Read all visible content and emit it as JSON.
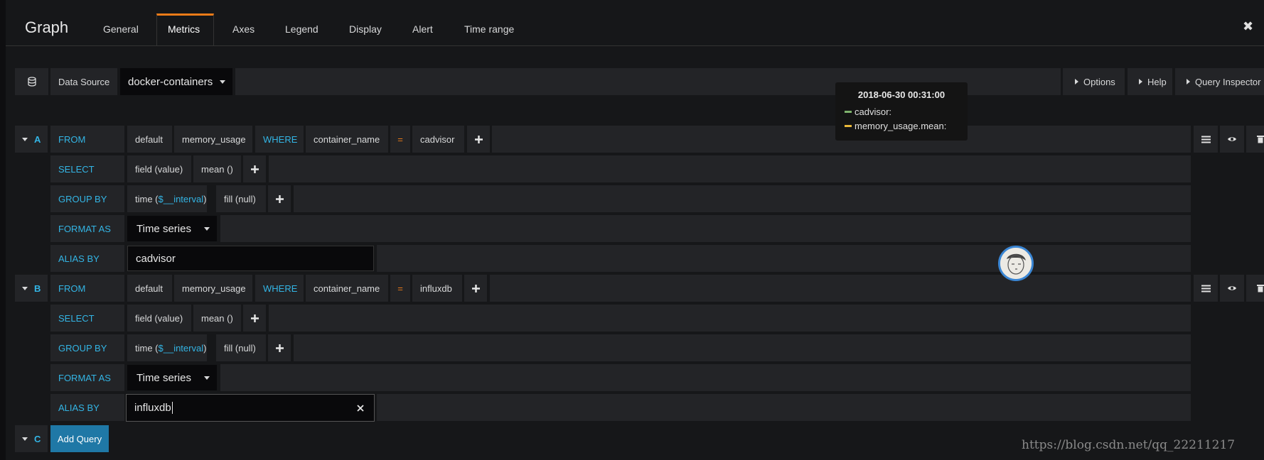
{
  "header": {
    "title": "Graph",
    "tabs": [
      "General",
      "Metrics",
      "Axes",
      "Legend",
      "Display",
      "Alert",
      "Time range"
    ],
    "active_tab": "Metrics",
    "close_glyph": "✖"
  },
  "datasource": {
    "label": "Data Source",
    "value": "docker-containers",
    "options": "Options",
    "help": "Help",
    "query_inspector": "Query Inspector"
  },
  "tooltip": {
    "time": "2018-06-30 00:31:00",
    "series": [
      {
        "name": "cadvisor:",
        "color": "#7eb26d"
      },
      {
        "name": "memory_usage.mean:",
        "color": "#eab839"
      }
    ]
  },
  "queries": [
    {
      "letter": "A",
      "from_label": "FROM",
      "policy": "default",
      "measurement": "memory_usage",
      "where_label": "WHERE",
      "tag_key": "container_name",
      "operator": "=",
      "tag_value": "cadvisor",
      "select_label": "SELECT",
      "field": "field (value)",
      "func": "mean ()",
      "group_label": "GROUP BY",
      "time_prefix": "time (",
      "interval": "$__interval",
      "time_suffix": ")",
      "fill": "fill (null)",
      "format_label": "FORMAT AS",
      "format": "Time series",
      "alias_label": "ALIAS BY",
      "alias": "cadvisor"
    },
    {
      "letter": "B",
      "from_label": "FROM",
      "policy": "default",
      "measurement": "memory_usage",
      "where_label": "WHERE",
      "tag_key": "container_name",
      "operator": "=",
      "tag_value": "influxdb",
      "select_label": "SELECT",
      "field": "field (value)",
      "func": "mean ()",
      "group_label": "GROUP BY",
      "time_prefix": "time (",
      "interval": "$__interval",
      "time_suffix": ")",
      "fill": "fill (null)",
      "format_label": "FORMAT AS",
      "format": "Time series",
      "alias_label": "ALIAS BY",
      "alias": "influxdb"
    }
  ],
  "next_letter": "C",
  "add_query": "Add Query",
  "watermark": "https://blog.csdn.net/qq_22211217"
}
